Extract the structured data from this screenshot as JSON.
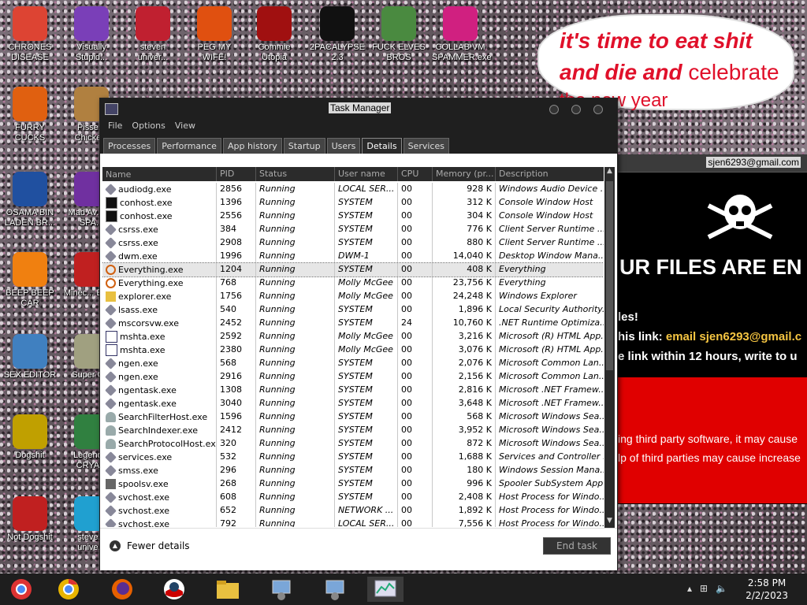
{
  "desktop_icons": [
    {
      "label": "CHRONES DISEASE",
      "icon": "chrome-icon",
      "color": "#dd4433"
    },
    {
      "label": "Visually Stupid...",
      "icon": "visual-studio-icon",
      "color": "#7a3fb8"
    },
    {
      "label": "steven univer...",
      "icon": "steven-universe-icon",
      "color": "#c02030"
    },
    {
      "label": "PEG MY WIFE!",
      "icon": "peggle-icon",
      "color": "#e05010"
    },
    {
      "label": "Commie Utopia",
      "icon": "commie-utopia-icon",
      "color": "#a01010"
    },
    {
      "label": "2PACALYPSE 2.3",
      "icon": "cmd-icon",
      "color": "#111111"
    },
    {
      "label": "FUCK ELVES BROS",
      "icon": "elves-icon",
      "color": "#4a8a40"
    },
    {
      "label": "COLLAB VM SPAMMER.exe",
      "icon": "collab-vm-icon",
      "color": "#d02080"
    },
    {
      "label": "FURRY CUCKS",
      "icon": "firefox-icon",
      "color": "#e06010"
    },
    {
      "label": "Pisse... Chicke...",
      "icon": "chicken-icon",
      "color": "#b08040"
    },
    {
      "label": "OSAMA BIN LADEN BR...",
      "icon": "obama-logo-icon",
      "color": "#2050a0"
    },
    {
      "label": "Mad Av... IN SPA...",
      "icon": "angry-birds-space-icon",
      "color": "#7030a0"
    },
    {
      "label": "BEEP BEEP CAR",
      "icon": "vlc-icon",
      "color": "#f08010"
    },
    {
      "label": "Minec... Bird...",
      "icon": "angry-bird-icon",
      "color": "#c02020"
    },
    {
      "label": "SEX EDITOR",
      "icon": "hxd-icon",
      "color": "#4080c0"
    },
    {
      "label": "Super C...",
      "icon": "super-c-icon",
      "color": "#a0a080"
    },
    {
      "label": "Dogshit",
      "icon": "dev-cpp-dogshit-icon",
      "color": "#c0a000"
    },
    {
      "label": "Legend... CRYA...",
      "icon": "zelda-icon",
      "color": "#308040"
    },
    {
      "label": "Not Dogshit",
      "icon": "dev-cpp-icon",
      "color": "#c02020"
    },
    {
      "label": "steve... unive...",
      "icon": "gem-icon",
      "color": "#20a0d0"
    }
  ],
  "bubble": {
    "line1": "it's time to eat shit",
    "line2a": "and die and",
    "line2b": "celebrate",
    "line3": "the new year"
  },
  "ransom": {
    "email_title": "sjen6293@gmail.com",
    "headline": "UR FILES ARE EN",
    "line1": "les!",
    "line2_label": "his link:",
    "line2_value": "email sjen6293@gmail.c",
    "line3": "e link within 12 hours, write to u",
    "red_line1": "ing third party software, it may cause",
    "red_line2": "lp of third parties may cause increase"
  },
  "taskmanager": {
    "title": "Task Manager",
    "menu": [
      "File",
      "Options",
      "View"
    ],
    "tabs": [
      "Processes",
      "Performance",
      "App history",
      "Startup",
      "Users",
      "Details",
      "Services"
    ],
    "active_tab": "Details",
    "columns": [
      "Name",
      "PID",
      "Status",
      "User name",
      "CPU",
      "Memory (pr...",
      "Description"
    ],
    "rows": [
      {
        "name": "audiodg.exe",
        "pid": "2856",
        "status": "Running",
        "user": "LOCAL SER...",
        "cpu": "00",
        "mem": "928 K",
        "desc": "Windows Audio Device ...",
        "icon": "gear"
      },
      {
        "name": "conhost.exe",
        "pid": "1396",
        "status": "Running",
        "user": "SYSTEM",
        "cpu": "00",
        "mem": "312 K",
        "desc": "Console Window Host",
        "icon": "cmd"
      },
      {
        "name": "conhost.exe",
        "pid": "2556",
        "status": "Running",
        "user": "SYSTEM",
        "cpu": "00",
        "mem": "304 K",
        "desc": "Console Window Host",
        "icon": "cmd"
      },
      {
        "name": "csrss.exe",
        "pid": "384",
        "status": "Running",
        "user": "SYSTEM",
        "cpu": "00",
        "mem": "776 K",
        "desc": "Client Server Runtime ...",
        "icon": "gear"
      },
      {
        "name": "csrss.exe",
        "pid": "2908",
        "status": "Running",
        "user": "SYSTEM",
        "cpu": "00",
        "mem": "880 K",
        "desc": "Client Server Runtime ...",
        "icon": "gear"
      },
      {
        "name": "dwm.exe",
        "pid": "1996",
        "status": "Running",
        "user": "DWM-1",
        "cpu": "00",
        "mem": "14,040 K",
        "desc": "Desktop Window Mana...",
        "icon": "gear"
      },
      {
        "name": "Everything.exe",
        "pid": "1204",
        "status": "Running",
        "user": "SYSTEM",
        "cpu": "00",
        "mem": "408 K",
        "desc": "Everything",
        "icon": "search",
        "selected": true
      },
      {
        "name": "Everything.exe",
        "pid": "768",
        "status": "Running",
        "user": "Molly McGee",
        "cpu": "00",
        "mem": "23,756 K",
        "desc": "Everything",
        "icon": "search"
      },
      {
        "name": "explorer.exe",
        "pid": "1756",
        "status": "Running",
        "user": "Molly McGee",
        "cpu": "00",
        "mem": "24,248 K",
        "desc": "Windows Explorer",
        "icon": "folder"
      },
      {
        "name": "lsass.exe",
        "pid": "540",
        "status": "Running",
        "user": "SYSTEM",
        "cpu": "00",
        "mem": "1,896 K",
        "desc": "Local Security Authority...",
        "icon": "gear"
      },
      {
        "name": "mscorsvw.exe",
        "pid": "2452",
        "status": "Running",
        "user": "SYSTEM",
        "cpu": "24",
        "mem": "10,760 K",
        "desc": ".NET Runtime Optimiza...",
        "icon": "gear"
      },
      {
        "name": "mshta.exe",
        "pid": "2592",
        "status": "Running",
        "user": "Molly McGee",
        "cpu": "00",
        "mem": "3,216 K",
        "desc": "Microsoft (R) HTML App...",
        "icon": "win"
      },
      {
        "name": "mshta.exe",
        "pid": "2380",
        "status": "Running",
        "user": "Molly McGee",
        "cpu": "00",
        "mem": "3,076 K",
        "desc": "Microsoft (R) HTML App...",
        "icon": "win"
      },
      {
        "name": "ngen.exe",
        "pid": "568",
        "status": "Running",
        "user": "SYSTEM",
        "cpu": "00",
        "mem": "2,076 K",
        "desc": "Microsoft Common Lan...",
        "icon": "gear"
      },
      {
        "name": "ngen.exe",
        "pid": "2916",
        "status": "Running",
        "user": "SYSTEM",
        "cpu": "00",
        "mem": "2,156 K",
        "desc": "Microsoft Common Lan...",
        "icon": "gear"
      },
      {
        "name": "ngentask.exe",
        "pid": "1308",
        "status": "Running",
        "user": "SYSTEM",
        "cpu": "00",
        "mem": "2,816 K",
        "desc": "Microsoft .NET Framew...",
        "icon": "gear"
      },
      {
        "name": "ngentask.exe",
        "pid": "3040",
        "status": "Running",
        "user": "SYSTEM",
        "cpu": "00",
        "mem": "3,648 K",
        "desc": "Microsoft .NET Framew...",
        "icon": "gear"
      },
      {
        "name": "SearchFilterHost.exe",
        "pid": "1596",
        "status": "Running",
        "user": "SYSTEM",
        "cpu": "00",
        "mem": "568 K",
        "desc": "Microsoft Windows Sea...",
        "icon": "person"
      },
      {
        "name": "SearchIndexer.exe",
        "pid": "2412",
        "status": "Running",
        "user": "SYSTEM",
        "cpu": "00",
        "mem": "3,952 K",
        "desc": "Microsoft Windows Sea...",
        "icon": "person"
      },
      {
        "name": "SearchProtocolHost.exe",
        "pid": "320",
        "status": "Running",
        "user": "SYSTEM",
        "cpu": "00",
        "mem": "872 K",
        "desc": "Microsoft Windows Sea...",
        "icon": "person"
      },
      {
        "name": "services.exe",
        "pid": "532",
        "status": "Running",
        "user": "SYSTEM",
        "cpu": "00",
        "mem": "1,688 K",
        "desc": "Services and Controller ...",
        "icon": "gear"
      },
      {
        "name": "smss.exe",
        "pid": "296",
        "status": "Running",
        "user": "SYSTEM",
        "cpu": "00",
        "mem": "180 K",
        "desc": "Windows Session Mana...",
        "icon": "gear"
      },
      {
        "name": "spoolsv.exe",
        "pid": "268",
        "status": "Running",
        "user": "SYSTEM",
        "cpu": "00",
        "mem": "996 K",
        "desc": "Spooler SubSystem App",
        "icon": "printer"
      },
      {
        "name": "svchost.exe",
        "pid": "608",
        "status": "Running",
        "user": "SYSTEM",
        "cpu": "00",
        "mem": "2,408 K",
        "desc": "Host Process for Windo...",
        "icon": "gear"
      },
      {
        "name": "svchost.exe",
        "pid": "652",
        "status": "Running",
        "user": "NETWORK ...",
        "cpu": "00",
        "mem": "1,892 K",
        "desc": "Host Process for Windo...",
        "icon": "gear"
      },
      {
        "name": "svchost.exe",
        "pid": "792",
        "status": "Running",
        "user": "LOCAL SER...",
        "cpu": "00",
        "mem": "7,556 K",
        "desc": "Host Process for Windo...",
        "icon": "gear"
      }
    ],
    "fewer_details": "Fewer details",
    "end_task": "End task"
  },
  "taskbar": {
    "items": [
      "chrome-taskbar-icon",
      "chrome-taskbar-icon",
      "firefox-taskbar-icon",
      "obama-taskbar-icon",
      "explorer-taskbar-icon",
      "installer-taskbar-icon",
      "installer-taskbar-icon",
      "task-manager-taskbar-icon"
    ],
    "time": "2:58 PM",
    "date": "2/2/2023"
  },
  "colors": {
    "ransom_red": "#e00000",
    "bubble_text": "#e0102a",
    "link_yellow": "#f5c542",
    "taskbar": "#1e1e1e"
  }
}
